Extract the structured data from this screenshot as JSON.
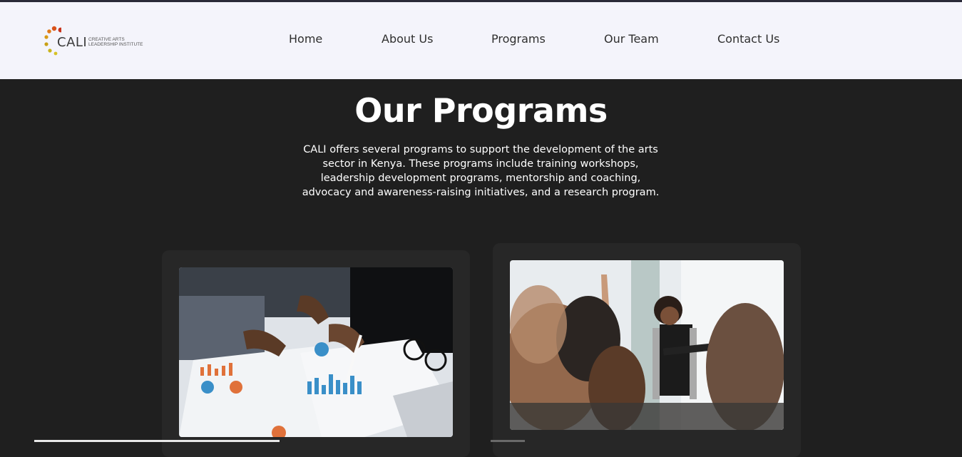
{
  "logo": {
    "name": "CALI",
    "subtitle_line1": "CREATIVE ARTS",
    "subtitle_line2": "LEADERSHIP INSTITUTE"
  },
  "nav": [
    "Home",
    "About Us",
    "Programs",
    "Our Team",
    "Contact Us"
  ],
  "hero": {
    "title": "Our Programs",
    "description": "CALI offers several programs to support the development of the arts sector in Kenya. These programs include training workshops, leadership development programs, mentorship and coaching, advocacy and awareness-raising initiatives, and a research program."
  },
  "colors": {
    "header_bg": "#f4f4fb",
    "page_bg": "#1f1f1f",
    "card_bg": "#272727",
    "logo_dots": [
      "#e07b1a",
      "#c8341c",
      "#d99a16",
      "#c9b41a"
    ]
  }
}
